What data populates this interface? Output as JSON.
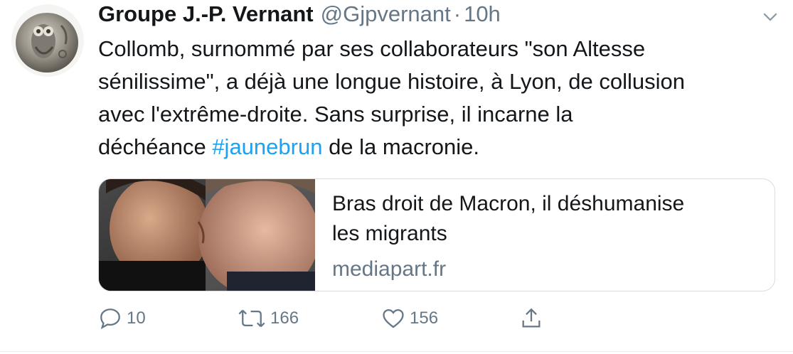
{
  "tweet": {
    "display_name": "Groupe J.-P. Vernant",
    "handle": "@Gjpvernant",
    "separator": "·",
    "time": "10h",
    "text_lines": [
      "Collomb, surnommé par ses collaborateurs \"son Altesse",
      "sénilissime\", a déjà une longue histoire, à Lyon, de collusion",
      "avec l'extrême-droite. Sans surprise, il incarne la"
    ],
    "text_last_before": "déchéance ",
    "hashtag": "#jaunebrun",
    "text_last_after": " de la macronie."
  },
  "card": {
    "title_line1": "Bras droit de Macron, il déshumanise",
    "title_line2": "les migrants",
    "domain": "mediapart.fr"
  },
  "actions": {
    "reply_count": "10",
    "retweet_count": "166",
    "like_count": "156"
  },
  "icons": {
    "avatar": "owl-coin-avatar",
    "menu": "chevron-down-icon",
    "reply": "reply-icon",
    "retweet": "retweet-icon",
    "like": "heart-icon",
    "share": "share-icon"
  },
  "colors": {
    "text": "#14171a",
    "secondary": "#657786",
    "link": "#1da1f2",
    "border": "#d6dde3"
  }
}
